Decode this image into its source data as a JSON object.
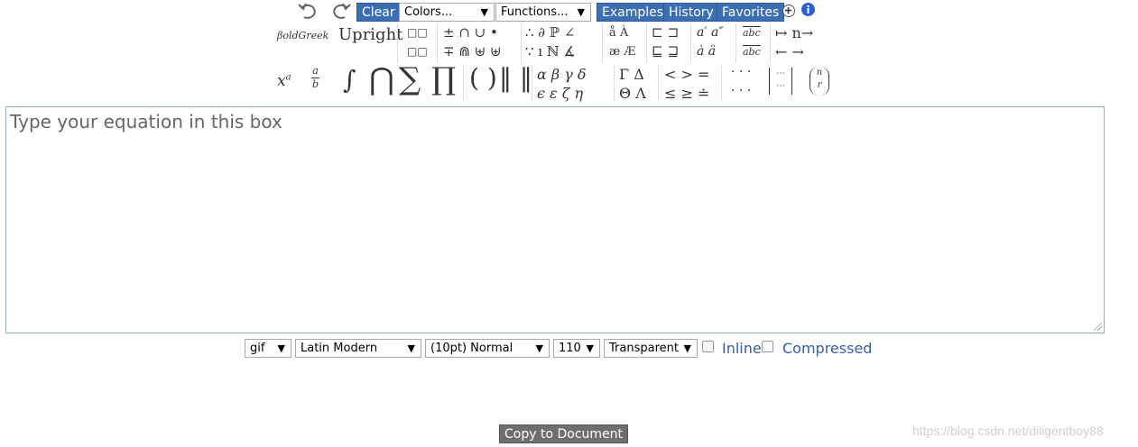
{
  "toolbar": {
    "clear_label": "Clear",
    "colors_select": "Colors...",
    "functions_select": "Functions...",
    "examples_label": "Examples",
    "history_label": "History",
    "favorites_label": "Favorites",
    "accent_color": "#3c6eb4"
  },
  "palette": {
    "style_bold_greek": "βoldGreek",
    "style_upright": "Upright",
    "boxes_top": "□□",
    "boxes_bottom": "□□",
    "setops_top": "± ∩ ∪ •",
    "setops_bottom": "∓ ⋒ ⊎ ⊎",
    "logic_top": "∴ ∂ ℙ ∠",
    "logic_bottom": "∵ ı ℕ ∡",
    "accents_top": "å À",
    "accents_bottom": "æ Æ",
    "subset_top": "⊏ ⊐",
    "subset_bottom": "⊑ ⊒",
    "primes_top": "a′ a″",
    "primes_bottom": "ȧ ä",
    "hat_top": "abc",
    "hat_bottom": "abc",
    "arrows_top": "↦ n→",
    "arrows_bottom": "← →",
    "superscript": "x",
    "superscript_exp": "a",
    "frac_num": "a",
    "frac_den": "b",
    "integral": "∫",
    "bigcap": "⋂",
    "sum": "∑",
    "prod": "∏",
    "parens": "( )",
    "norms": "‖ ‖",
    "greek_top": "α β γ δ",
    "greek_bottom": "ϵ ε ζ η",
    "cap_greek_top": "Γ Δ",
    "cap_greek_bottom": "Θ Λ",
    "relations_top": "< > =",
    "relations_bottom": "≤ ≥ ≐",
    "dots_top": "· · ·",
    "dots_bottom": "· · ·",
    "matrix": "⋯",
    "binom_top": "n",
    "binom_bottom": "r"
  },
  "editor": {
    "placeholder": "Type your equation in this box"
  },
  "options": {
    "format": "gif",
    "font": "Latin Modern",
    "size": "(10pt) Normal",
    "dpi": "110",
    "background": "Transparent",
    "inline_label": "Inline",
    "compressed_label": "Compressed"
  },
  "footer": {
    "copy_label": "Copy to Document",
    "watermark": "https://blog.csdn.net/diligentboy88"
  }
}
